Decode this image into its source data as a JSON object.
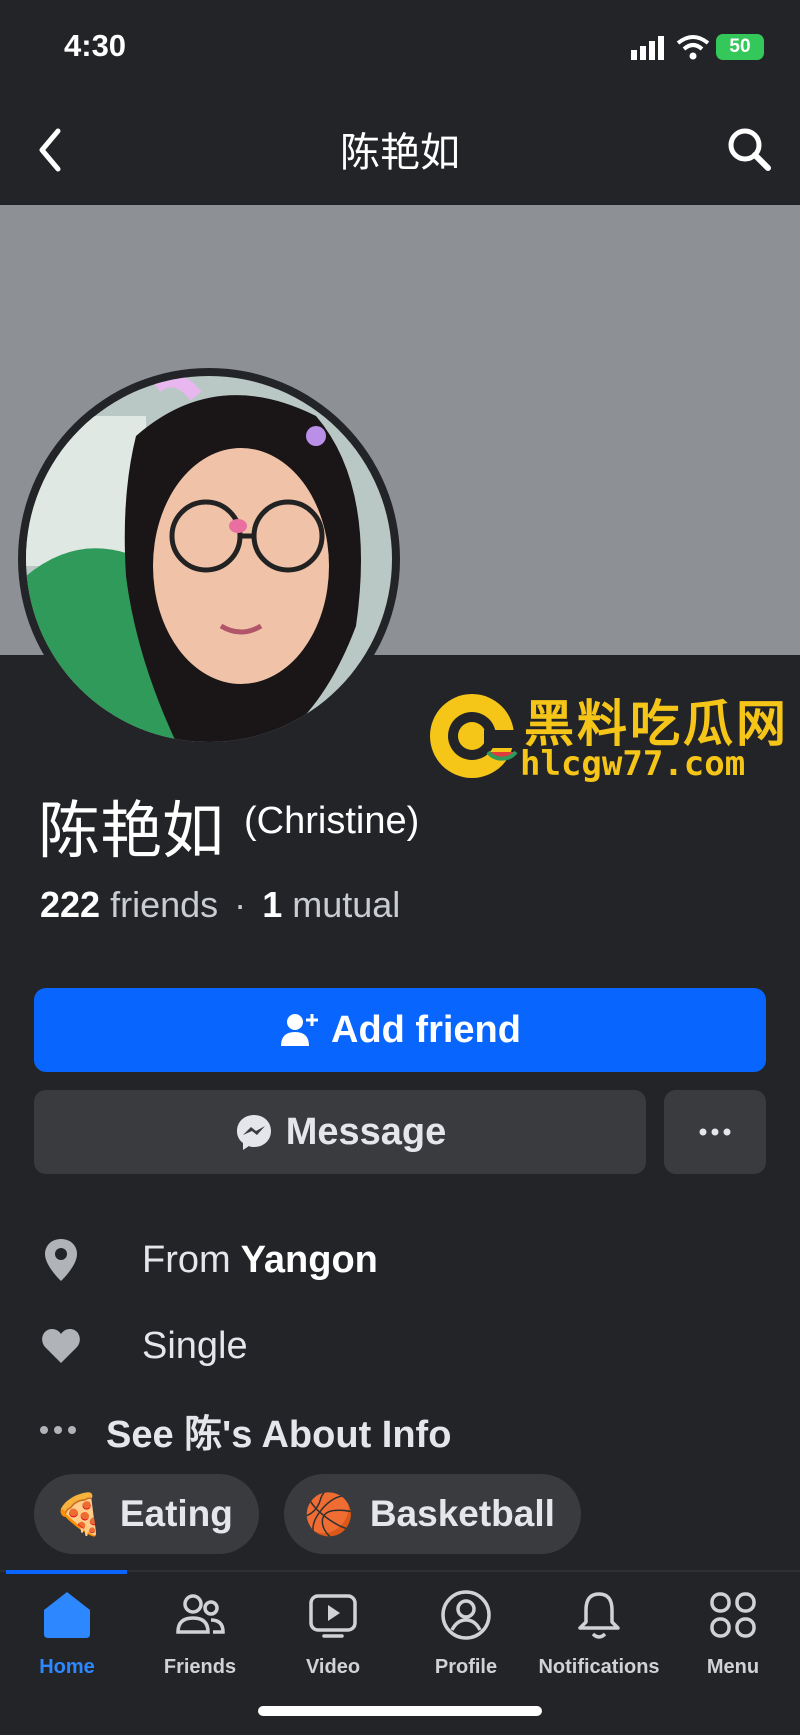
{
  "status_bar": {
    "time": "4:30",
    "battery": "50"
  },
  "nav": {
    "title": "陈艳如"
  },
  "profile": {
    "name": "陈艳如",
    "alt_name": "(Christine)",
    "friends_count": "222",
    "friends_label": "friends",
    "separator": "·",
    "mutual_count": "1",
    "mutual_label": "mutual"
  },
  "watermark": {
    "cn": "黑料吃瓜网",
    "url": "hlcgw77.com"
  },
  "buttons": {
    "add_friend": "Add friend",
    "message": "Message",
    "more": "···"
  },
  "intro": {
    "from_prefix": "From",
    "from_city": "Yangon",
    "relationship": "Single",
    "see_about": "See 陈's About Info"
  },
  "hobbies": [
    {
      "emoji": "🍕",
      "label": "Eating"
    },
    {
      "emoji": "🏀",
      "label": "Basketball"
    }
  ],
  "tabs": [
    {
      "label": "Home",
      "icon": "home-icon",
      "active": true
    },
    {
      "label": "Friends",
      "icon": "friends-icon"
    },
    {
      "label": "Video",
      "icon": "video-icon"
    },
    {
      "label": "Profile",
      "icon": "profile-icon"
    },
    {
      "label": "Notifications",
      "icon": "bell-icon"
    },
    {
      "label": "Menu",
      "icon": "menu-grid-icon"
    }
  ],
  "colors": {
    "accent": "#0866ff",
    "background": "#232428",
    "button": "#3a3b3f",
    "cover": "#8d9095",
    "watermark": "#f5c518"
  }
}
